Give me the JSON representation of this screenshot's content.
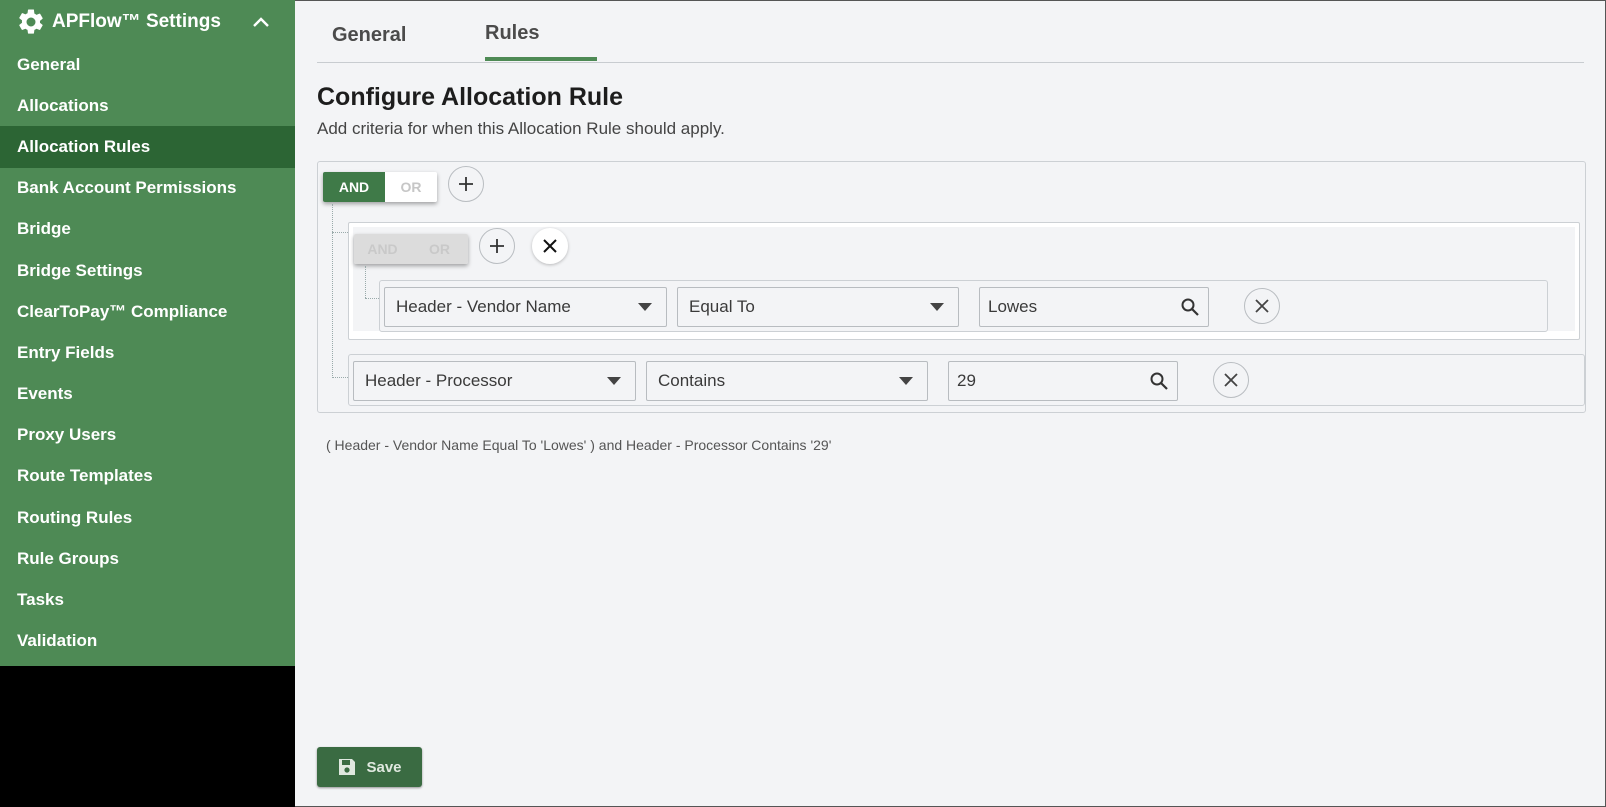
{
  "sidebar": {
    "title": "APFlow™ Settings",
    "items": [
      {
        "label": "General",
        "active": false
      },
      {
        "label": "Allocations",
        "active": false
      },
      {
        "label": "Allocation Rules",
        "active": true
      },
      {
        "label": "Bank Account Permissions",
        "active": false
      },
      {
        "label": "Bridge",
        "active": false
      },
      {
        "label": "Bridge Settings",
        "active": false
      },
      {
        "label": "ClearToPay™ Compliance",
        "active": false
      },
      {
        "label": "Entry Fields",
        "active": false
      },
      {
        "label": "Events",
        "active": false
      },
      {
        "label": "Proxy Users",
        "active": false
      },
      {
        "label": "Route Templates",
        "active": false
      },
      {
        "label": "Routing Rules",
        "active": false
      },
      {
        "label": "Rule Groups",
        "active": false
      },
      {
        "label": "Tasks",
        "active": false
      },
      {
        "label": "Validation",
        "active": false
      }
    ]
  },
  "tabs": [
    {
      "label": "General",
      "active": false
    },
    {
      "label": "Rules",
      "active": true
    }
  ],
  "page": {
    "title": "Configure Allocation Rule",
    "subtitle": "Add criteria for when this Allocation Rule should apply."
  },
  "builder": {
    "root": {
      "and_label": "AND",
      "or_label": "OR",
      "selected": "AND"
    },
    "group": {
      "and_label": "AND",
      "or_label": "OR",
      "disabled": true
    },
    "rule1": {
      "field": "Header - Vendor Name",
      "operator": "Equal To",
      "value": "Lowes"
    },
    "rule2": {
      "field": "Header - Processor",
      "operator": "Contains",
      "value": "29"
    }
  },
  "summary": "( Header - Vendor Name Equal To 'Lowes' ) and Header - Processor Contains '29'",
  "save_label": "Save",
  "colors": {
    "sidebar": "#4e8a55",
    "sidebar_active": "#2c6534",
    "accent": "#3f7a48"
  }
}
